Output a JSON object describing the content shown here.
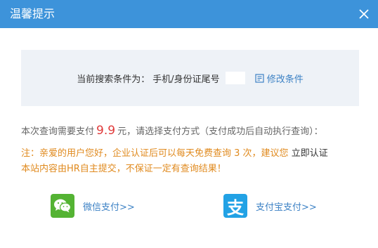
{
  "dialog": {
    "title": "温馨提示",
    "close_icon": "close-icon"
  },
  "condition": {
    "label": "当前搜索条件为：",
    "value": "手机/身份证尾号",
    "modify_label": "修改条件",
    "modify_icon": "edit-icon"
  },
  "payment": {
    "prefix": "本次查询需要支付",
    "price": "9.9",
    "suffix": "元，请选择支付方式（支付成功后自动执行查询）："
  },
  "notice": {
    "part1": "注：亲爱的用户您好，企业认证后可以每天免费查询 3 次，建议您",
    "certify_link": "立即认证",
    "line2": "本站内容由HR自主提交，不保证一定有查询结果！"
  },
  "pay_options": {
    "wechat_label": "微信支付>>",
    "alipay_label": "支付宝支付>>",
    "alipay_glyph": "支"
  },
  "colors": {
    "titlebar": "#3d93da",
    "price": "#e03a3a",
    "notice": "#e08a1e",
    "link": "#3d82c5",
    "wechat": "#54b333",
    "alipay": "#22a2e5"
  }
}
